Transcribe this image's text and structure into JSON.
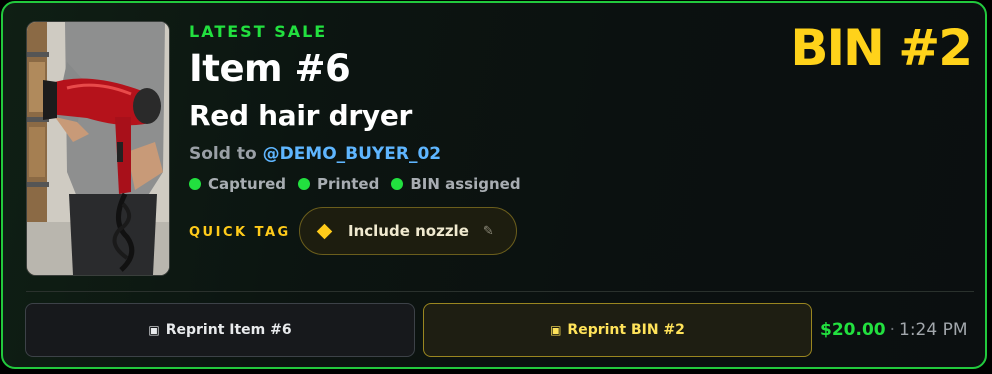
{
  "sale": {
    "eyebrow": "LATEST SALE",
    "item_title": "Item #6",
    "bin_label": "BIN #2",
    "description": "Red hair dryer",
    "sold_to_prefix": "Sold to",
    "buyer_handle": "@DEMO_BUYER_02",
    "statuses": [
      {
        "label": "Captured",
        "color": "#22e03f"
      },
      {
        "label": "Printed",
        "color": "#22e03f"
      },
      {
        "label": "BIN assigned",
        "color": "#22e03f"
      }
    ],
    "quick_tag": {
      "label": "QUICK TAG",
      "chip_text": "Include nozzle",
      "chip_icon": "diamond-icon",
      "edit_icon": "pencil-icon"
    },
    "thumbnail": {
      "icon": "product-photo",
      "subject": "person holding red hair dryer"
    }
  },
  "actions": {
    "reprint_item": "Reprint Item #6",
    "reprint_bin": "Reprint BIN #2",
    "button_glyph": "▣"
  },
  "footer": {
    "price": "$20.00",
    "separator": "·",
    "time": "1:24 PM"
  },
  "colors": {
    "accent_green": "#22e03f",
    "accent_yellow": "#ffd21a",
    "buyer_blue": "#5fb6ff",
    "card_border": "#22c93d"
  }
}
